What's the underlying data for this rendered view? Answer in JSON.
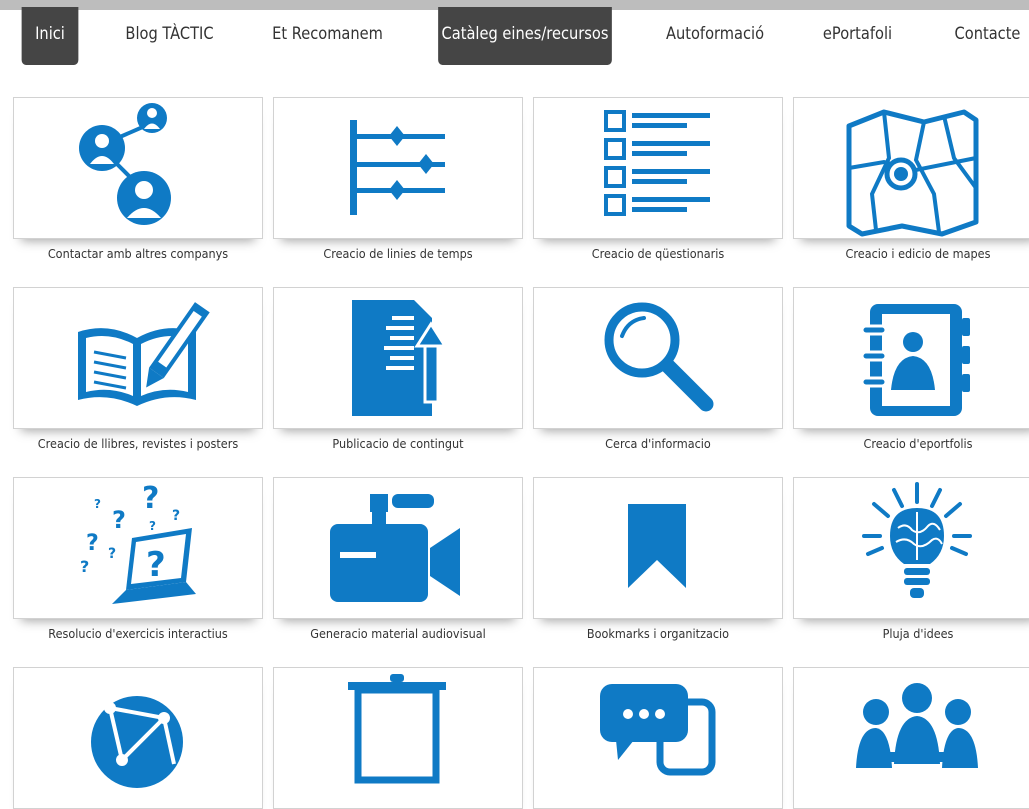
{
  "nav": {
    "items": [
      "Inici",
      "Blog TÀCTIC",
      "Et Recomanem",
      "Catàleg eines/recursos",
      "Autoformació",
      "ePortafoli",
      "Contacte"
    ]
  },
  "colors": {
    "accent": "#0f7ac5",
    "nav_active": "#454545"
  },
  "catalog": {
    "tiles": [
      {
        "label": "Contactar amb altres companys",
        "icon": "contacts-network-icon"
      },
      {
        "label": "Creacio de linies de temps",
        "icon": "timeline-icon"
      },
      {
        "label": "Creacio de qüestionaris",
        "icon": "questionnaire-list-icon"
      },
      {
        "label": "Creacio i edicio de mapes",
        "icon": "map-pin-icon"
      },
      {
        "label": "Creacio de llibres, revistes i posters",
        "icon": "book-pencil-icon"
      },
      {
        "label": "Publicacio de contingut",
        "icon": "document-upload-icon"
      },
      {
        "label": "Cerca d'informacio",
        "icon": "magnifier-icon"
      },
      {
        "label": "Creacio d'eportfolis",
        "icon": "portfolio-binder-icon"
      },
      {
        "label": "Resolucio d'exercicis interactius",
        "icon": "laptop-questions-icon"
      },
      {
        "label": "Generacio material audiovisual",
        "icon": "video-camera-icon"
      },
      {
        "label": "Bookmarks i organitzacio",
        "icon": "bookmark-icon"
      },
      {
        "label": "Pluja d'idees",
        "icon": "brain-bulb-icon"
      },
      {
        "label": "",
        "icon": "globe-network-icon"
      },
      {
        "label": "",
        "icon": "projector-screen-icon"
      },
      {
        "label": "",
        "icon": "chat-bubble-icon"
      },
      {
        "label": "",
        "icon": "meeting-people-icon"
      }
    ]
  }
}
